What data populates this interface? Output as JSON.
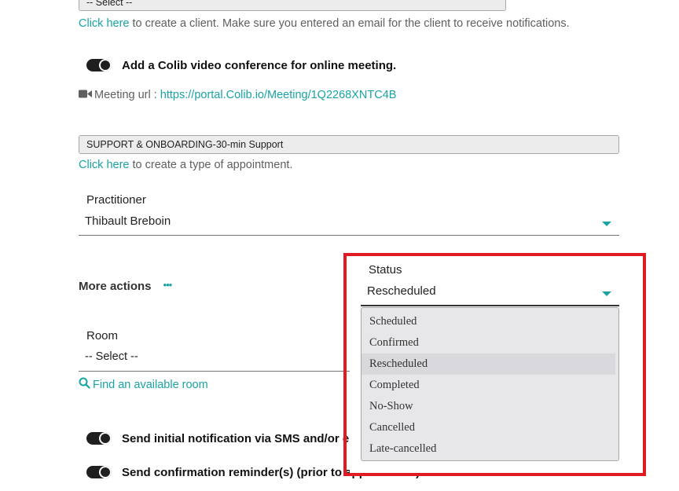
{
  "client": {
    "select_value": "-- Select --",
    "hint_link": "Click here",
    "hint_text": "to create a client. Make sure you entered an email for the client to receive notifications."
  },
  "video": {
    "toggle_label": "Add a Colib video conference for online meeting.",
    "url_label": "Meeting url :",
    "url": "https://portal.Colib.io/Meeting/1Q2268XNTC4B"
  },
  "appointment_type": {
    "select_value": "SUPPORT & ONBOARDING-30-min Support",
    "hint_link": "Click here",
    "hint_text": "to create a type of appointment."
  },
  "practitioner": {
    "label": "Practitioner",
    "value": "Thibault Breboin"
  },
  "more_actions": {
    "label": "More actions",
    "dots": "•••"
  },
  "status": {
    "label": "Status",
    "value": "Rescheduled",
    "options": [
      "Scheduled",
      "Confirmed",
      "Rescheduled",
      "Completed",
      "No-Show",
      "Cancelled",
      "Late-cancelled"
    ],
    "selected_index": 2
  },
  "room": {
    "label": "Room",
    "value": "-- Select --",
    "find_link": "Find an available room"
  },
  "notifications": {
    "initial_label": "Send initial notification via SMS and/or email.",
    "reminder_label": "Send confirmation reminder(s) (prior to appointment)."
  },
  "colors": {
    "accent": "#1aa3a3",
    "highlight": "#e01b24"
  }
}
